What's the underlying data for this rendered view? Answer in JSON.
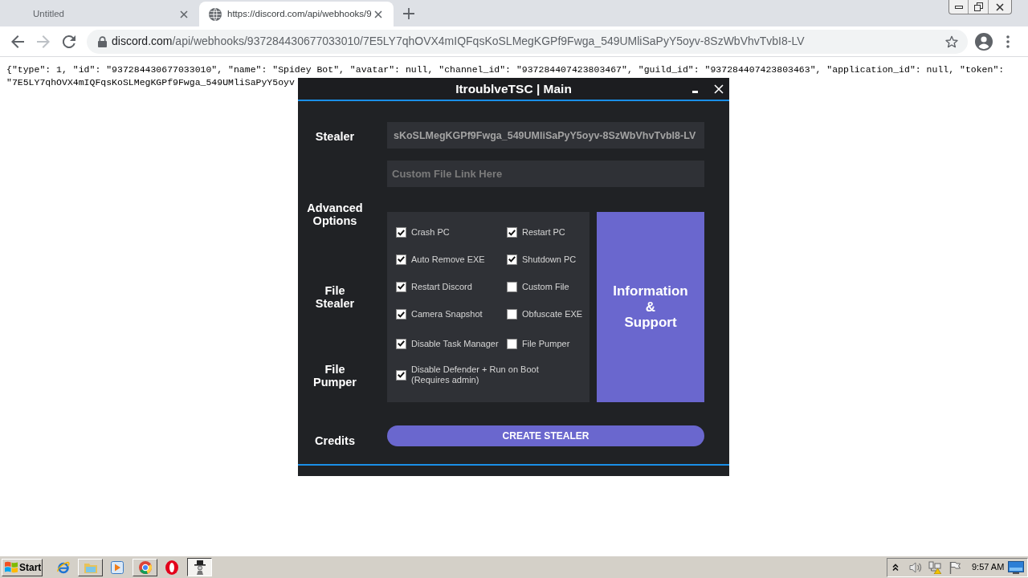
{
  "browser": {
    "tabs": [
      {
        "title": "Untitled",
        "favicon": false,
        "selected": false
      },
      {
        "title": "https://discord.com/api/webhooks/9",
        "favicon": true,
        "selected": true
      }
    ],
    "back_button": {
      "disabled": false
    },
    "forward_button": {
      "disabled": true
    },
    "address_bar": {
      "host": "discord.com",
      "path": "/api/webhooks/937284430677033010/7E5LY7qhOVX4mIQFqsKoSLMegKGPf9Fwga_549UMliSaPyY5oyv-8SzWbVhvTvbI8-LV"
    }
  },
  "page": {
    "lines": [
      "{\"type\": 1, \"id\": \"937284430677033010\", \"name\": \"Spidey Bot\", \"avatar\": null, \"channel_id\": \"937284407423803467\", \"guild_id\": \"937284407423803463\", \"application_id\": null, \"token\":",
      "\"7E5LY7qhOVX4mIQFqsKoSLMegKGPf9Fwga_549UMliSaPyY5oyv"
    ]
  },
  "app_window": {
    "title": "ItroublveTSC | Main",
    "nav": [
      "Stealer",
      "Advanced\nOptions",
      "File\nStealer",
      "File\nPumper",
      "Credits"
    ],
    "webhook_field": {
      "value": "sKoSLMegKGPf9Fwga_549UMliSaPyY5oyv-8SzWbVhvTvbI8-LV"
    },
    "custom_file_field": {
      "placeholder": "Custom File Link Here"
    },
    "options": [
      {
        "label": "Crash PC",
        "checked": true
      },
      {
        "label": "Restart PC",
        "checked": true
      },
      {
        "label": "Auto Remove EXE",
        "checked": true
      },
      {
        "label": "Shutdown PC",
        "checked": true
      },
      {
        "label": "Restart Discord",
        "checked": true
      },
      {
        "label": "Custom File",
        "checked": false
      },
      {
        "label": "Camera Snapshot",
        "checked": true
      },
      {
        "label": "Obfuscate EXE",
        "checked": false
      },
      {
        "label": "Disable Task Manager",
        "checked": true
      },
      {
        "label": "File Pumper",
        "checked": false
      },
      {
        "label": "Disable Defender + Run on Boot\n(Requires admin)",
        "checked": true
      }
    ],
    "info_button": "Information\n&\nSupport",
    "create_button": "CREATE STEALER"
  },
  "taskbar": {
    "start": "Start",
    "clock": "9:57 AM"
  }
}
